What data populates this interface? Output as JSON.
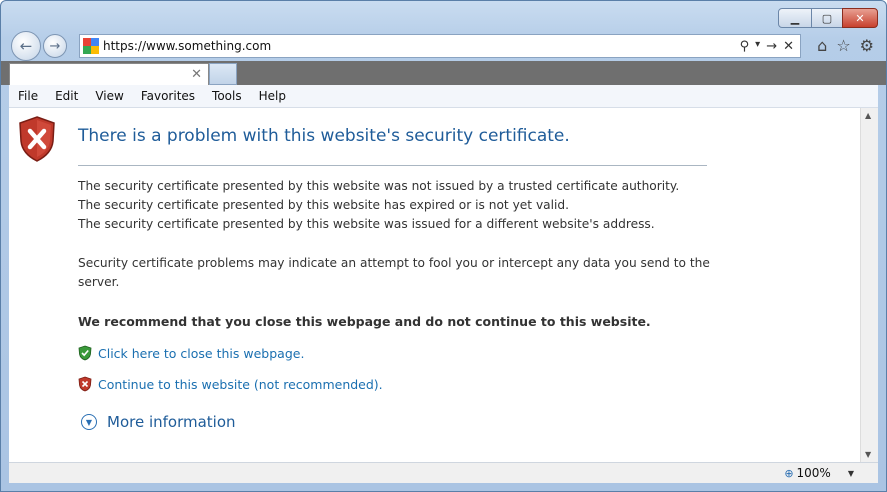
{
  "window": {
    "controls": {
      "minimize_icon": "minimize-icon",
      "restore_icon": "restore-icon",
      "close_icon": "close-icon"
    }
  },
  "nav": {
    "url": "https://www.something.com",
    "search_glyph": "⚲",
    "dropdown_glyph": "▾",
    "go_glyph": "→",
    "stop_glyph": "✕",
    "home_glyph": "⌂",
    "favorites_glyph": "☆",
    "tools_glyph": "⚙"
  },
  "tab": {
    "title": "",
    "close_glyph": "✕"
  },
  "menubar": [
    "File",
    "Edit",
    "View",
    "Favorites",
    "Tools",
    "Help"
  ],
  "page": {
    "heading": "There is a problem with this website's security certificate.",
    "reasons": [
      "The security certificate presented by this website was not issued by a trusted certificate authority.",
      "The security certificate presented by this website has expired or is not yet valid.",
      "The security certificate presented by this website was issued for a different website's address."
    ],
    "warning_line1": "Security certificate problems may indicate an attempt to fool you or intercept any data you send to the",
    "warning_line2": "server.",
    "recommend": "We recommend that you close this webpage and do not continue to this website.",
    "close_link": "Click here to close this webpage.",
    "continue_link": "Continue to this website (not recommended).",
    "more_info": "More information"
  },
  "status": {
    "zoom": "100%"
  },
  "colors": {
    "heading": "#1f5c99",
    "link": "#1a6fb0",
    "shield_green": "#3a9a3a",
    "shield_red": "#c0392b"
  }
}
